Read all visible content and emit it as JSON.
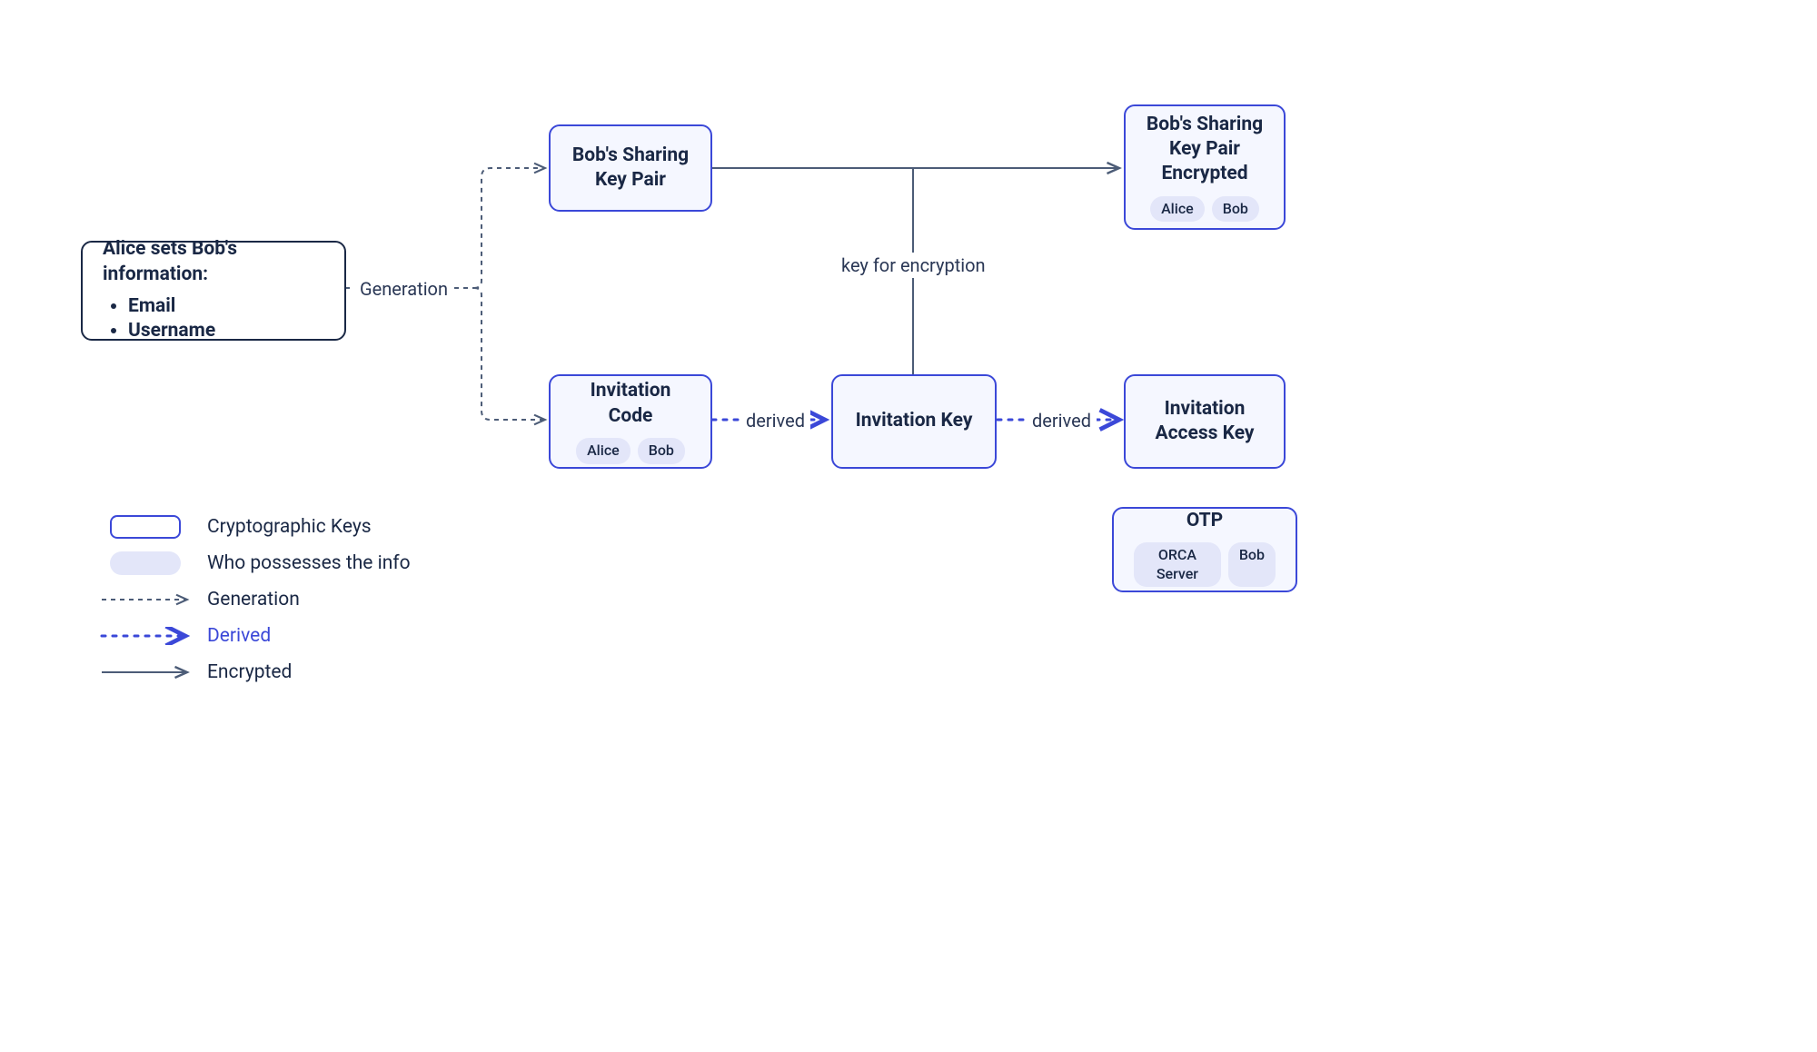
{
  "nodes": {
    "alice_info": {
      "title": "Alice sets Bob's information:",
      "items": [
        "Email",
        "Username"
      ]
    },
    "bob_keypair": {
      "title": "Bob's Sharing",
      "subtitle": "Key Pair"
    },
    "bob_keypair_enc": {
      "title": "Bob's Sharing",
      "line2": "Key Pair",
      "line3": "Encrypted",
      "tags": [
        "Alice",
        "Bob"
      ]
    },
    "inv_code": {
      "title": "Invitation Code",
      "tags": [
        "Alice",
        "Bob"
      ]
    },
    "inv_key": {
      "title": "Invitation Key"
    },
    "inv_access": {
      "title": "Invitation",
      "subtitle": "Access Key"
    },
    "otp": {
      "title": "OTP",
      "tags": [
        "ORCA Server",
        "Bob"
      ]
    }
  },
  "edge_labels": {
    "generation": "Generation",
    "derived1": "derived",
    "derived2": "derived",
    "key_for_enc": "key for encryption"
  },
  "legend": {
    "crypto_keys": "Cryptographic Keys",
    "possesses": "Who possesses the info",
    "generation": "Generation",
    "derived": "Derived",
    "encrypted": "Encrypted"
  },
  "colors": {
    "dark": "#1a2845",
    "blue": "#3b48d8",
    "lightBlue": "#f5f7ff",
    "pill": "#e3e6f9",
    "gray": "#4c5c77"
  }
}
